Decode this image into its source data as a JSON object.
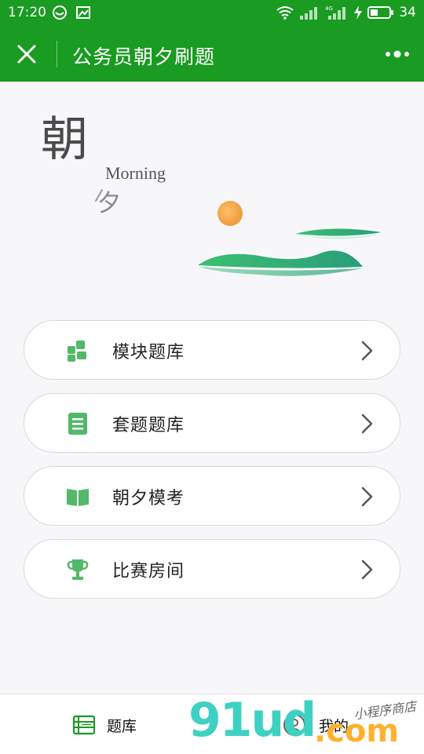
{
  "status_bar": {
    "time": "17:20",
    "battery": "34",
    "network_label": "4G"
  },
  "nav": {
    "title": "公务员朝夕刷题"
  },
  "hero": {
    "char_large": "朝",
    "word": "Morning",
    "char_small": "夕"
  },
  "menu": [
    {
      "label": "模块题库",
      "icon": "grid-blocks-icon"
    },
    {
      "label": "套题题库",
      "icon": "document-list-icon"
    },
    {
      "label": "朝夕模考",
      "icon": "open-book-icon"
    },
    {
      "label": "比赛房间",
      "icon": "trophy-icon"
    }
  ],
  "tabs": [
    {
      "label": "题库",
      "icon": "question-bank-icon"
    },
    {
      "label": "我的",
      "icon": "profile-icon"
    }
  ],
  "watermark": {
    "main": "91ud",
    "suffix": ".com",
    "small": "小程序商店"
  },
  "colors": {
    "brand_green": "#1a9b22",
    "icon_green": "#52b86a",
    "sun_orange": "#f2a44a"
  }
}
